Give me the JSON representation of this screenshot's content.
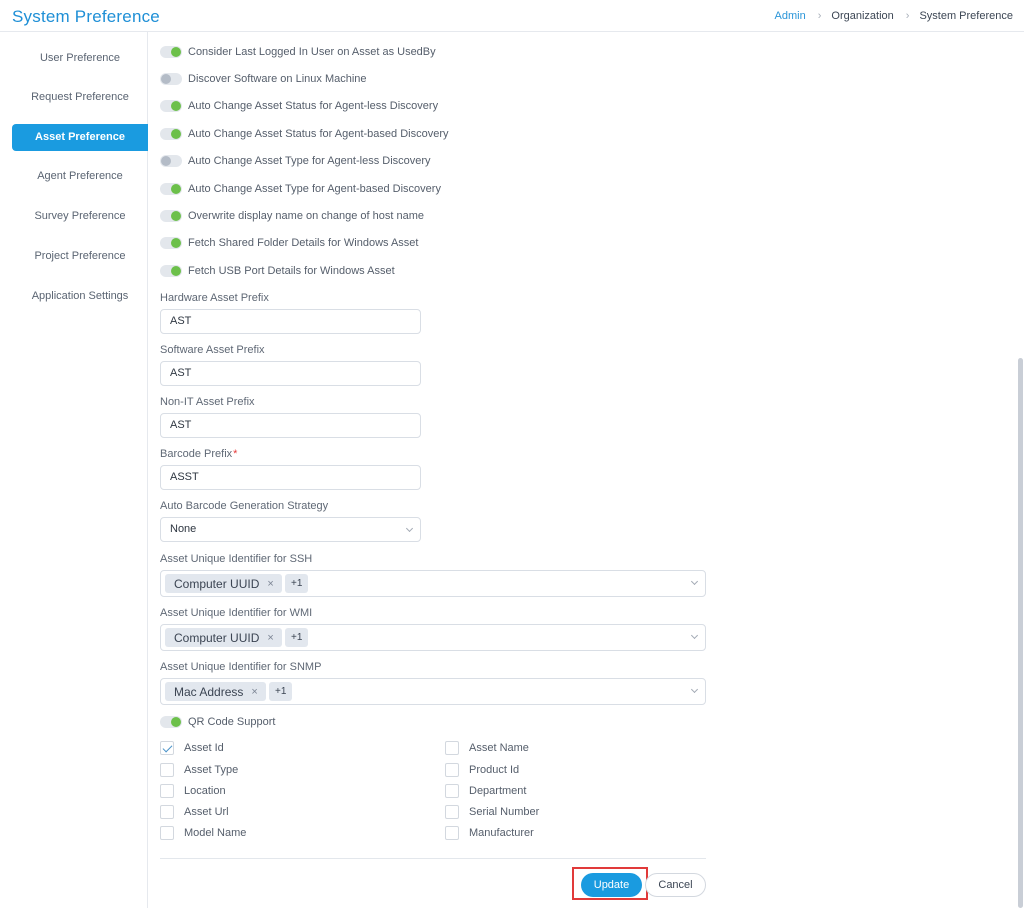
{
  "header": {
    "title": "System Preference",
    "breadcrumb": [
      "Admin",
      "Organization",
      "System Preference"
    ]
  },
  "sidebar": {
    "items": [
      {
        "label": "User Preference"
      },
      {
        "label": "Request Preference"
      },
      {
        "label": "Asset Preference",
        "active": true
      },
      {
        "label": "Agent Preference"
      },
      {
        "label": "Survey Preference"
      },
      {
        "label": "Project Preference"
      },
      {
        "label": "Application Settings"
      }
    ]
  },
  "toggles": [
    {
      "label": "Consider Last Logged In User on Asset as UsedBy",
      "on": true
    },
    {
      "label": "Discover Software on Linux Machine",
      "on": false
    },
    {
      "label": "Auto Change Asset Status for Agent-less Discovery",
      "on": true
    },
    {
      "label": "Auto Change Asset Status for Agent-based Discovery",
      "on": true
    },
    {
      "label": "Auto Change Asset Type for Agent-less Discovery",
      "on": false
    },
    {
      "label": "Auto Change Asset Type for Agent-based Discovery",
      "on": true
    },
    {
      "label": "Overwrite display name on change of host name",
      "on": true
    },
    {
      "label": "Fetch Shared Folder Details for Windows Asset",
      "on": true
    },
    {
      "label": "Fetch USB Port Details for Windows Asset",
      "on": true
    }
  ],
  "fields": {
    "hardware_prefix": {
      "label": "Hardware Asset Prefix",
      "value": "AST"
    },
    "software_prefix": {
      "label": "Software Asset Prefix",
      "value": "AST"
    },
    "nonit_prefix": {
      "label": "Non-IT Asset Prefix",
      "value": "AST"
    },
    "barcode_prefix": {
      "label": "Barcode Prefix",
      "required_mark": "*",
      "value": "ASST"
    },
    "barcode_strategy": {
      "label": "Auto Barcode Generation Strategy",
      "value": "None"
    }
  },
  "identifiers": {
    "ssh": {
      "label": "Asset Unique Identifier for SSH",
      "tag": "Computer UUID",
      "more": "+1"
    },
    "wmi": {
      "label": "Asset Unique Identifier for WMI",
      "tag": "Computer UUID",
      "more": "+1"
    },
    "snmp": {
      "label": "Asset Unique Identifier for SNMP",
      "tag": "Mac Address",
      "more": "+1"
    }
  },
  "tag_remove_glyph": "×",
  "qr": {
    "label": "QR Code Support",
    "on": true
  },
  "qr_fields": {
    "left": [
      {
        "label": "Asset Id",
        "checked": true
      },
      {
        "label": "Asset Type",
        "checked": false
      },
      {
        "label": "Location",
        "checked": false
      },
      {
        "label": "Asset Url",
        "checked": false
      },
      {
        "label": "Model Name",
        "checked": false
      }
    ],
    "right": [
      {
        "label": "Asset Name",
        "checked": false
      },
      {
        "label": "Product Id",
        "checked": false
      },
      {
        "label": "Department",
        "checked": false
      },
      {
        "label": "Serial Number",
        "checked": false
      },
      {
        "label": "Manufacturer",
        "checked": false
      }
    ]
  },
  "actions": {
    "update": "Update",
    "cancel": "Cancel"
  }
}
